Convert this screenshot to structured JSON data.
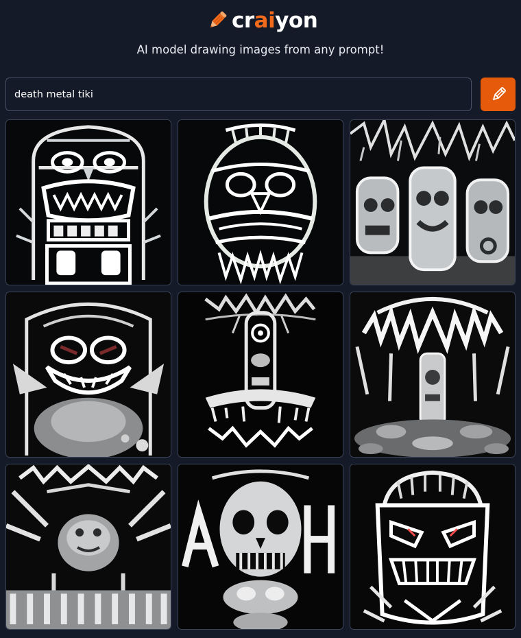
{
  "brand": {
    "part1": "cr",
    "accent": "ai",
    "part2": "yon",
    "accent_color": "#f26a1b"
  },
  "tagline": "AI model drawing images from any prompt!",
  "prompt": {
    "value": "death metal tiki"
  },
  "draw_button": {
    "icon": "pencil-icon",
    "color": "#e65a0c"
  },
  "colors": {
    "background": "#141a28",
    "tile_border": "#3c4558"
  }
}
